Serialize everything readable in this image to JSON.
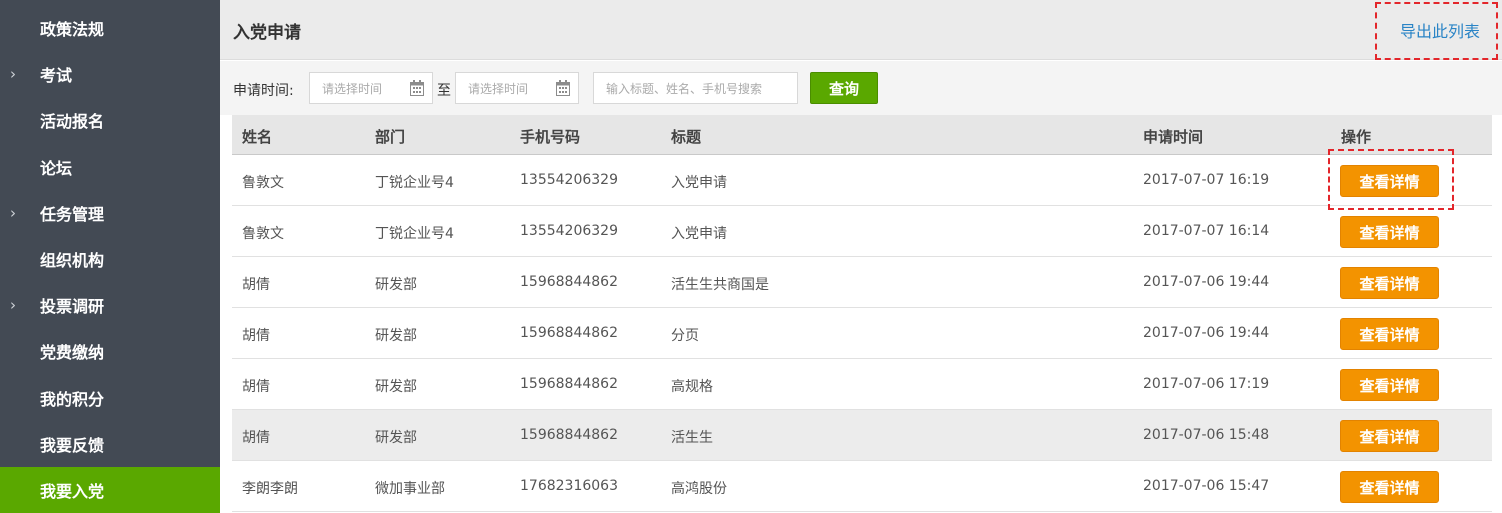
{
  "sidebar": {
    "items": [
      {
        "label": "政策法规",
        "arrow": ""
      },
      {
        "label": "考试",
        "arrow": "›"
      },
      {
        "label": "活动报名",
        "arrow": ""
      },
      {
        "label": "论坛",
        "arrow": ""
      },
      {
        "label": "任务管理",
        "arrow": "›"
      },
      {
        "label": "组织机构",
        "arrow": ""
      },
      {
        "label": "投票调研",
        "arrow": "›"
      },
      {
        "label": "党费缴纳",
        "arrow": ""
      },
      {
        "label": "我的积分",
        "arrow": ""
      },
      {
        "label": "我要反馈",
        "arrow": ""
      },
      {
        "label": "我要入党",
        "arrow": "",
        "active": true
      }
    ]
  },
  "header": {
    "title": "入党申请",
    "export_label": "导出此列表"
  },
  "filter": {
    "label": "申请时间:",
    "start_placeholder": "请选择时间",
    "to_label": "至",
    "end_placeholder": "请选择时间",
    "search_placeholder": "输入标题、姓名、手机号搜索",
    "query_label": "查询"
  },
  "table": {
    "headers": [
      "姓名",
      "部门",
      "手机号码",
      "标题",
      "申请时间",
      "操作"
    ],
    "action_label": "查看详情",
    "rows": [
      [
        "鲁敦文",
        "丁锐企业号4",
        "13554206329",
        "入党申请",
        "2017-07-07 16:19"
      ],
      [
        "鲁敦文",
        "丁锐企业号4",
        "13554206329",
        "入党申请",
        "2017-07-07 16:14"
      ],
      [
        "胡倩",
        "研发部",
        "15968844862",
        "活生生共商国是",
        "2017-07-06 19:44"
      ],
      [
        "胡倩",
        "研发部",
        "15968844862",
        "分页",
        "2017-07-06 19:44"
      ],
      [
        "胡倩",
        "研发部",
        "15968844862",
        "高规格",
        "2017-07-06 17:19"
      ],
      [
        "胡倩",
        "研发部",
        "15968844862",
        "活生生",
        "2017-07-06 15:48"
      ],
      [
        "李朗李朗",
        "微加事业部",
        "17682316063",
        "高鸿股份",
        "2017-07-06 15:47"
      ]
    ]
  },
  "colors": {
    "sidebar_bg": "#434a54",
    "active_green": "#5aa800",
    "action_orange": "#f39300",
    "link_blue": "#2a84c6",
    "annotation_red": "#e3262b"
  }
}
